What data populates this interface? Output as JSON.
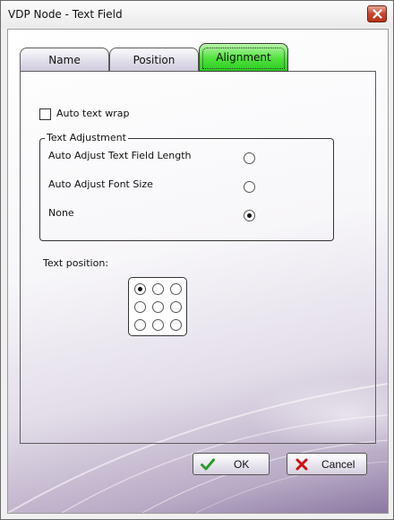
{
  "window": {
    "title": "VDP Node - Text Field"
  },
  "tabs": [
    {
      "label": "Name",
      "active": false
    },
    {
      "label": "Position",
      "active": false
    },
    {
      "label": "Alignment",
      "active": true
    }
  ],
  "alignment": {
    "auto_wrap": {
      "label": "Auto text wrap",
      "checked": false
    },
    "text_adjustment": {
      "legend": "Text Adjustment",
      "options": [
        {
          "label": "Auto Adjust Text Field Length",
          "selected": false
        },
        {
          "label": "Auto Adjust Font Size",
          "selected": false
        },
        {
          "label": "None",
          "selected": true
        }
      ]
    },
    "text_position": {
      "label": "Text position:",
      "grid": [
        [
          true,
          false,
          false
        ],
        [
          false,
          false,
          false
        ],
        [
          false,
          false,
          false
        ]
      ]
    }
  },
  "buttons": {
    "ok": {
      "label": "OK",
      "icon": "checkmark-icon"
    },
    "cancel": {
      "label": "Cancel",
      "icon": "red-x-icon"
    }
  },
  "colors": {
    "active_tab": "#4fe23c",
    "close_button": "#c7462e",
    "ok_check": "#2e9a2e",
    "cancel_x": "#cc1111"
  }
}
